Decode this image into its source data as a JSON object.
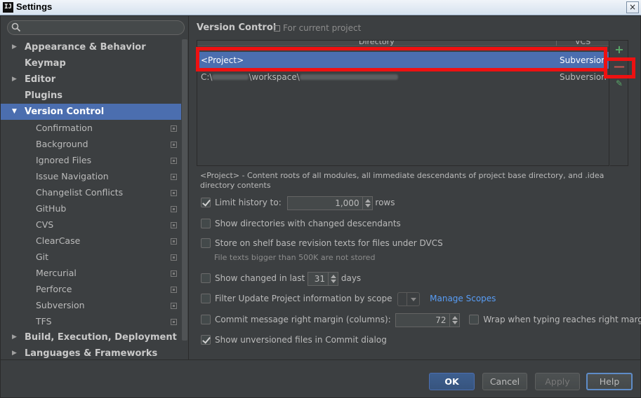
{
  "window": {
    "app_icon": "IJ",
    "title": "Settings",
    "close_label": "×"
  },
  "sidebar": {
    "search_placeholder": "",
    "items": [
      {
        "label": "Appearance & Behavior",
        "level": 0,
        "arrow": "▶"
      },
      {
        "label": "Keymap",
        "level": 0,
        "arrow": ""
      },
      {
        "label": "Editor",
        "level": 0,
        "arrow": "▶"
      },
      {
        "label": "Plugins",
        "level": 0,
        "arrow": ""
      },
      {
        "label": "Version Control",
        "level": 0,
        "arrow": "▼",
        "selected": true
      },
      {
        "label": "Confirmation",
        "level": 1
      },
      {
        "label": "Background",
        "level": 1
      },
      {
        "label": "Ignored Files",
        "level": 1
      },
      {
        "label": "Issue Navigation",
        "level": 1
      },
      {
        "label": "Changelist Conflicts",
        "level": 1
      },
      {
        "label": "GitHub",
        "level": 1
      },
      {
        "label": "CVS",
        "level": 1
      },
      {
        "label": "ClearCase",
        "level": 1
      },
      {
        "label": "Git",
        "level": 1
      },
      {
        "label": "Mercurial",
        "level": 1
      },
      {
        "label": "Perforce",
        "level": 1
      },
      {
        "label": "Subversion",
        "level": 1
      },
      {
        "label": "TFS",
        "level": 1
      },
      {
        "label": "Build, Execution, Deployment",
        "level": 0,
        "arrow": "▶"
      },
      {
        "label": "Languages & Frameworks",
        "level": 0,
        "arrow": "▶"
      }
    ]
  },
  "main": {
    "title": "Version Control",
    "scope_note": "For current project",
    "table": {
      "col_directory": "Directory",
      "col_vcs": "VCS",
      "rows": [
        {
          "directory": "<Project>",
          "vcs": "Subversion"
        },
        {
          "directory_prefix": "C:\\",
          "directory_mid": "\\workspace\\",
          "vcs": "Subversion"
        }
      ]
    },
    "toolbar": {
      "add": "+",
      "remove": "—",
      "edit": "✎"
    },
    "description": "<Project> - Content roots of all modules, all immediate descendants of project base directory, and .idea directory contents",
    "options": {
      "limit_history_label": "Limit history to:",
      "limit_history_value": "1,000",
      "limit_history_unit": "rows",
      "show_dirs_label": "Show directories with changed descendants",
      "store_shelf_label": "Store on shelf base revision texts for files under DVCS",
      "store_shelf_hint": "File texts bigger than 500K are not stored",
      "show_changed_label": "Show changed in last",
      "show_changed_value": "31",
      "show_changed_unit": "days",
      "filter_update_label": "Filter Update Project information by scope",
      "manage_scopes_link": "Manage Scopes",
      "commit_margin_label": "Commit message right margin (columns):",
      "commit_margin_value": "72",
      "wrap_label": "Wrap when typing reaches right margin",
      "show_unversioned_label": "Show unversioned files in Commit dialog"
    }
  },
  "footer": {
    "ok": "OK",
    "cancel": "Cancel",
    "apply": "Apply",
    "help": "Help"
  },
  "colors": {
    "background": "#3c3f41",
    "selection": "#4b6eaf",
    "highlight_box": "#ee1111",
    "link": "#589df6"
  }
}
